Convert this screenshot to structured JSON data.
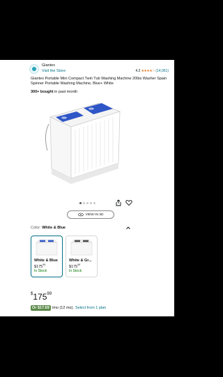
{
  "store": {
    "name": "Giantex",
    "visit_label": "Visit the Store",
    "rating": "4.2",
    "rating_stars": "★★★★☆",
    "rating_count": "(14,951)"
  },
  "product": {
    "title": "Giantex Portable Mini Compact Twin Tub Washing Machine 20lbs Washer Spain Spinner Portable Washing Machine, Blue+ White",
    "bought_bold": "300+ bought",
    "bought_rest": " in past month",
    "view3d_label": "VIEW IN 3D",
    "gallery_dots": 5,
    "gallery_active": 0
  },
  "color": {
    "label": "Color:",
    "selected": "White & Blue"
  },
  "variants": [
    {
      "name": "White & Blue",
      "price_whole": "175",
      "price_frac": "99",
      "stock": "In Stock",
      "lid_color": "#2f56c7"
    },
    {
      "name": "White & Gr...",
      "price_whole": "175",
      "price_frac": "99",
      "stock": "In Stock",
      "lid_color": "#4a4a4a"
    }
  ],
  "price": {
    "currency": "$",
    "whole": "175",
    "frac": "99"
  },
  "monthly": {
    "or_label": "Or $17.69",
    "term": "/mo (12 mo).",
    "select_label": "Select from 1 plan"
  },
  "colors": {
    "accent": "#007185",
    "star": "#de7921",
    "stock": "#007600",
    "lid_blue": "#2f56c7"
  }
}
